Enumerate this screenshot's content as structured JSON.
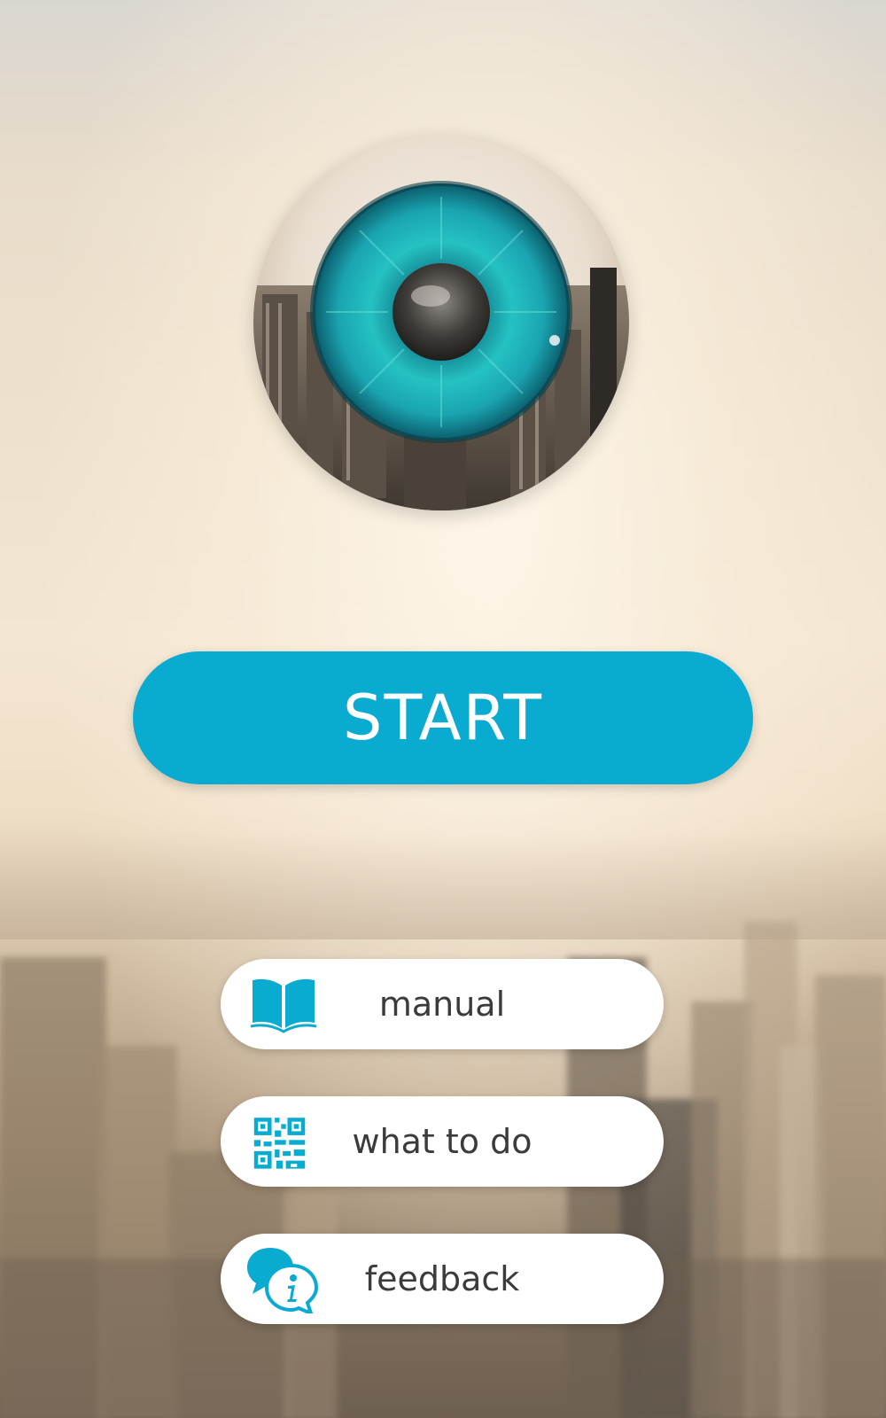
{
  "app": {
    "logo_icon": "eye-city-icon",
    "accent_color": "#0aabd0"
  },
  "start_button": {
    "label": "START"
  },
  "menu": [
    {
      "id": "manual",
      "label": "manual",
      "icon": "open-book-icon"
    },
    {
      "id": "what-to-do",
      "label": "what to do",
      "icon": "qr-code-icon"
    },
    {
      "id": "feedback",
      "label": "feedback",
      "icon": "info-chat-icon"
    }
  ]
}
